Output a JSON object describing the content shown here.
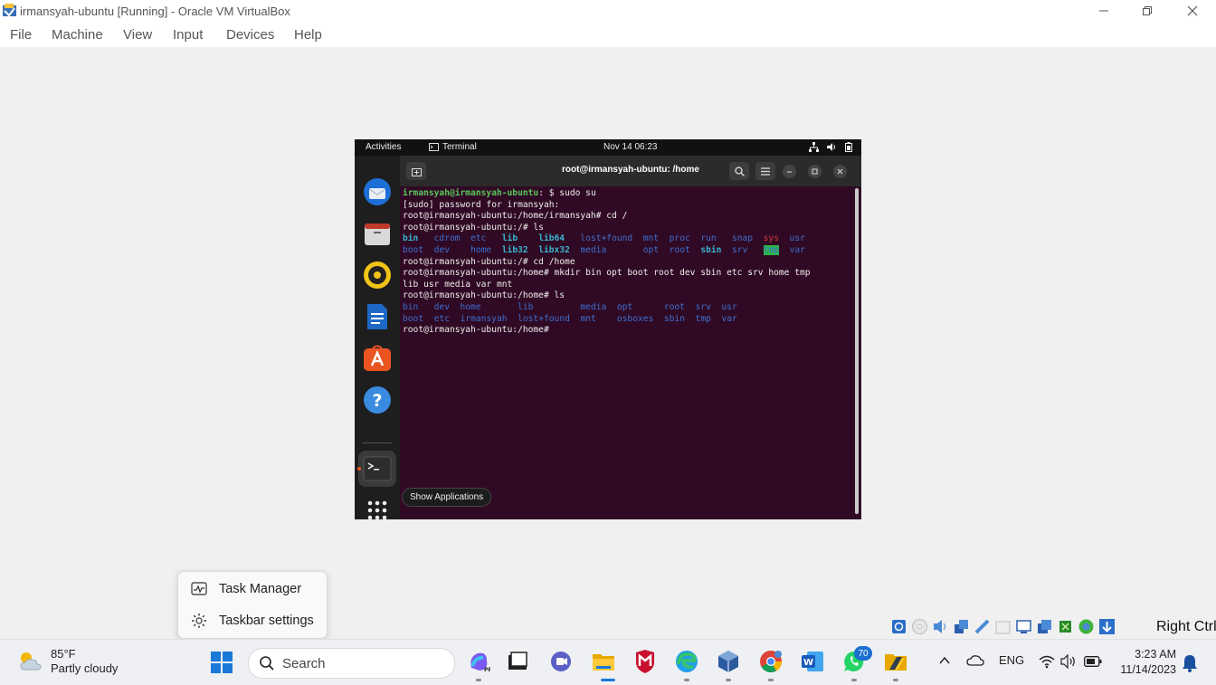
{
  "window": {
    "title": "irmansyah-ubuntu [Running] - Oracle VM VirtualBox",
    "controls": [
      "minimize",
      "restore",
      "close"
    ]
  },
  "menubar": {
    "items": [
      "File",
      "Machine",
      "View",
      "Input",
      "Devices",
      "Help"
    ]
  },
  "ubuntu": {
    "topbar": {
      "activities": "Activities",
      "app_name": "Terminal",
      "clock": "Nov 14  06:23"
    },
    "dock": {
      "apps": [
        "thunderbird-icon",
        "files-icon",
        "rhythmbox-icon",
        "libreoffice-writer-icon",
        "app-center-icon",
        "help-icon",
        "terminal-icon",
        "show-apps-grid-icon"
      ]
    },
    "terminal": {
      "title": "root@irmansyah-ubuntu: /home",
      "lines": [
        [
          {
            "t": "irmansyah@irmansyah-ubuntu",
            "c": "u"
          },
          {
            "t": ": $ sudo su"
          }
        ],
        [
          {
            "t": "[sudo] password for irmansyah:"
          }
        ],
        [
          {
            "t": "root@irmansyah-ubuntu:/home/irmansyah# cd /"
          }
        ],
        [
          {
            "t": "root@irmansyah-ubuntu:/# ls"
          }
        ],
        [
          {
            "t": "bin",
            "c": "lnk"
          },
          {
            "t": "   "
          },
          {
            "t": "cdrom",
            "c": "dir"
          },
          {
            "t": "  "
          },
          {
            "t": "etc",
            "c": "dir"
          },
          {
            "t": "   "
          },
          {
            "t": "lib",
            "c": "lnk"
          },
          {
            "t": "    "
          },
          {
            "t": "lib64",
            "c": "lnk"
          },
          {
            "t": "   "
          },
          {
            "t": "lost+found",
            "c": "dir"
          },
          {
            "t": "  "
          },
          {
            "t": "mnt",
            "c": "dir"
          },
          {
            "t": "  "
          },
          {
            "t": "proc",
            "c": "dir"
          },
          {
            "t": "  "
          },
          {
            "t": "run",
            "c": "dir"
          },
          {
            "t": "   "
          },
          {
            "t": "snap",
            "c": "dir"
          },
          {
            "t": "  "
          },
          {
            "t": "sys",
            "c": "sticky"
          },
          {
            "t": "  "
          },
          {
            "t": "usr",
            "c": "dir"
          }
        ],
        [
          {
            "t": "boot",
            "c": "dir"
          },
          {
            "t": "  "
          },
          {
            "t": "dev",
            "c": "dir"
          },
          {
            "t": "    "
          },
          {
            "t": "home",
            "c": "dir"
          },
          {
            "t": "  "
          },
          {
            "t": "lib32",
            "c": "lnk"
          },
          {
            "t": "  "
          },
          {
            "t": "libx32",
            "c": "lnk"
          },
          {
            "t": "  "
          },
          {
            "t": "media",
            "c": "dir"
          },
          {
            "t": "       "
          },
          {
            "t": "opt",
            "c": "dir"
          },
          {
            "t": "  "
          },
          {
            "t": "root",
            "c": "dir"
          },
          {
            "t": "  "
          },
          {
            "t": "sbin",
            "c": "lnk"
          },
          {
            "t": "  "
          },
          {
            "t": "srv",
            "c": "dir"
          },
          {
            "t": "   "
          },
          {
            "t": "tmp",
            "c": "ownw"
          },
          {
            "t": "  "
          },
          {
            "t": "var",
            "c": "dir"
          }
        ],
        [
          {
            "t": "root@irmansyah-ubuntu:/# cd /home"
          }
        ],
        [
          {
            "t": "root@irmansyah-ubuntu:/home# mkdir bin opt boot root dev sbin etc srv home tmp"
          }
        ],
        [
          {
            "t": "lib usr media var mnt"
          }
        ],
        [
          {
            "t": "root@irmansyah-ubuntu:/home# ls"
          }
        ],
        [
          {
            "t": "bin",
            "c": "dir"
          },
          {
            "t": "   "
          },
          {
            "t": "dev",
            "c": "dir"
          },
          {
            "t": "  "
          },
          {
            "t": "home",
            "c": "dir"
          },
          {
            "t": "       "
          },
          {
            "t": "lib",
            "c": "dir"
          },
          {
            "t": "         "
          },
          {
            "t": "media",
            "c": "dir"
          },
          {
            "t": "  "
          },
          {
            "t": "opt",
            "c": "dir"
          },
          {
            "t": "      "
          },
          {
            "t": "root",
            "c": "dir"
          },
          {
            "t": "  "
          },
          {
            "t": "srv",
            "c": "dir"
          },
          {
            "t": "  "
          },
          {
            "t": "usr",
            "c": "dir"
          }
        ],
        [
          {
            "t": "boot",
            "c": "dir"
          },
          {
            "t": "  "
          },
          {
            "t": "etc",
            "c": "dir"
          },
          {
            "t": "  "
          },
          {
            "t": "irmansyah",
            "c": "dir"
          },
          {
            "t": "  "
          },
          {
            "t": "lost+found",
            "c": "dir"
          },
          {
            "t": "  "
          },
          {
            "t": "mnt",
            "c": "dir"
          },
          {
            "t": "    "
          },
          {
            "t": "osboxes",
            "c": "dir"
          },
          {
            "t": "  "
          },
          {
            "t": "sbin",
            "c": "dir"
          },
          {
            "t": "  "
          },
          {
            "t": "tmp",
            "c": "dir"
          },
          {
            "t": "  "
          },
          {
            "t": "var",
            "c": "dir"
          }
        ],
        [
          {
            "t": "root@irmansyah-ubuntu:/home# "
          }
        ]
      ]
    },
    "tooltip": "Show Applications"
  },
  "context_menu": {
    "items": [
      {
        "label": "Task Manager",
        "icon": "task-manager-icon"
      },
      {
        "label": "Taskbar settings",
        "icon": "gear-icon"
      }
    ]
  },
  "vbox_status": {
    "host_key": "Right Ctrl"
  },
  "taskbar": {
    "weather": {
      "temp": "85°F",
      "desc": "Partly cloudy"
    },
    "search_label": "Search",
    "apps": [
      "copilot-icon",
      "terminal-app-icon",
      "teams-icon",
      "file-explorer-icon",
      "mcafee-icon",
      "edge-icon",
      "virtualbox-icon",
      "chrome-icon",
      "word-icon",
      "whatsapp-icon",
      "python-folder-icon"
    ],
    "whatsapp_badge": "70",
    "tray": {
      "language": "ENG"
    },
    "clock": {
      "time": "3:23 AM",
      "date": "11/14/2023"
    }
  },
  "colors": {
    "ubuntu_terminal_bg": "#300a24",
    "ubuntu_dock": "#1e1e1e",
    "username_green": "#5ac85a",
    "dir_blue": "#3c6fd0",
    "link_cyan": "#3ab4d0",
    "taskbar_bg": "#eef0f3"
  }
}
